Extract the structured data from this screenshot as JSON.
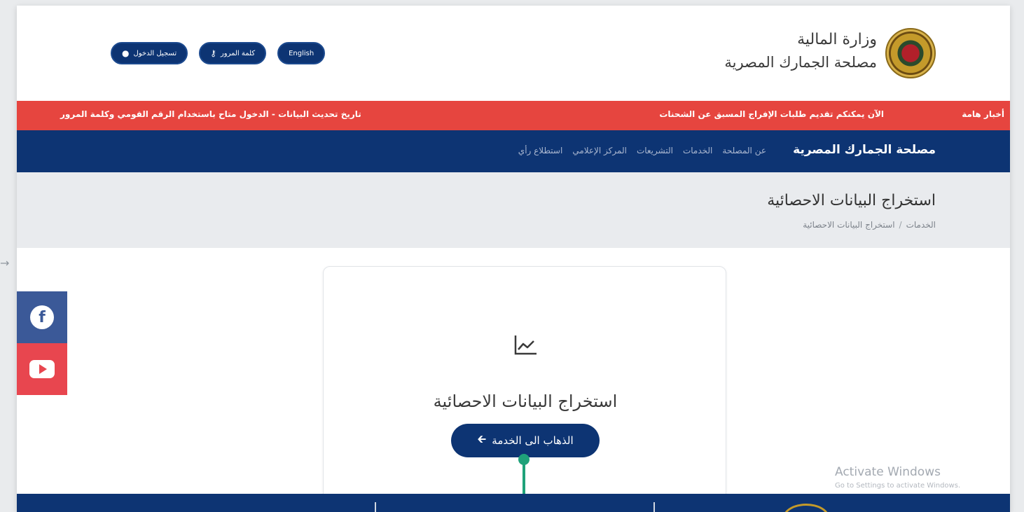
{
  "header": {
    "brand_line1": "وزارة المالية",
    "brand_line2": "مصلحة الجمارك المصرية",
    "buttons": [
      {
        "label": "تسجيل الدخول",
        "icon": "login-icon"
      },
      {
        "label": "كلمة المرور",
        "icon": "key-icon"
      },
      {
        "label": "English",
        "icon": "globe-icon"
      }
    ]
  },
  "ticker": {
    "label": "أخبار هامة",
    "item1": "الآن يمكنكم تقديم طلبات الإفراج المسبق عن الشحنات",
    "item2": "تاريخ تحديث البيانات - الدخول متاح باستخدام الرقم القومي وكلمة المرور"
  },
  "navbar": {
    "brand": "مصلحة الجمارك المصرية",
    "links": [
      "عن المصلحة",
      "الخدمات",
      "التشريعات",
      "المركز الإعلامي",
      "استطلاع رأي"
    ]
  },
  "page": {
    "title": "استخراج البيانات الاحصائية",
    "breadcrumb": [
      "الخدمات",
      "استخراج البيانات الاحصائية"
    ]
  },
  "card": {
    "icon": "chart-line-icon",
    "title": "استخراج البيانات الاحصائية",
    "button": "الذهاب الى الخدمة",
    "button_icon": "arrow-left-icon"
  },
  "watermark": {
    "line1": "Activate Windows",
    "line2": "Go to Settings to activate Windows."
  },
  "social": [
    "facebook-icon",
    "youtube-icon"
  ],
  "colors": {
    "navy": "#0d3473",
    "ticker_red": "#e6453f",
    "accent_green": "#1fa27a",
    "facebook": "#3b5998",
    "youtube": "#e8464f"
  }
}
